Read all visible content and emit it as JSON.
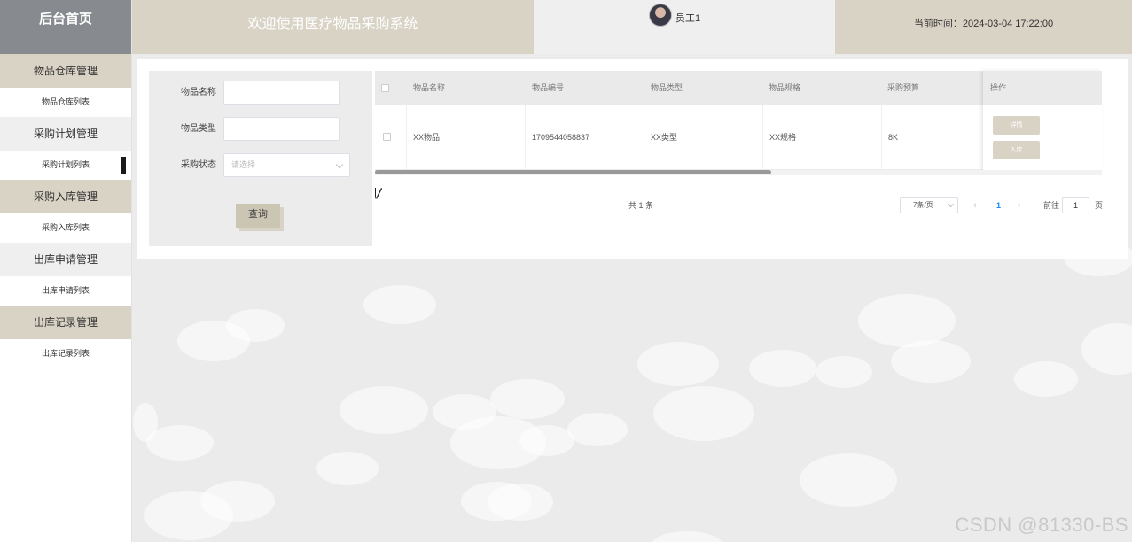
{
  "sidebar": {
    "brand": "后台首页",
    "groups": [
      {
        "label": "物品仓库管理",
        "item": "物品仓库列表"
      },
      {
        "label": "采购计划管理",
        "item": "采购计划列表"
      },
      {
        "label": "采购入库管理",
        "item": "采购入库列表"
      },
      {
        "label": "出库申请管理",
        "item": "出库申请列表"
      },
      {
        "label": "出库记录管理",
        "item": "出库记录列表"
      }
    ]
  },
  "header": {
    "title": "欢迎使用医疗物品采购系统",
    "username": "员工1",
    "time": "当前时间：2024-03-04 17:22:00"
  },
  "search": {
    "name_label": "物品名称",
    "type_label": "物品类型",
    "status_label": "采购状态",
    "status_placeholder": "请选择",
    "query_button": "查询"
  },
  "table": {
    "columns": [
      "物品名称",
      "物品编号",
      "物品类型",
      "物品规格",
      "采购预算",
      "操作"
    ],
    "rows": [
      {
        "name": "XX物品",
        "code": "1709544058837",
        "type": "XX类型",
        "spec": "XX规格",
        "budget": "8K",
        "detail": "详情",
        "stock_in": "入库"
      }
    ]
  },
  "pagination": {
    "total": "共 1 条",
    "page_size": "7条/页",
    "current_page": "1",
    "goto_label": "前往",
    "goto_value": "1",
    "page_suffix": "页"
  },
  "watermark": "CSDN @81330-BS",
  "colors": {
    "accent_beige": "#d9d3c6",
    "brand_gray": "#878b8f",
    "page_bg": "#ebebeb",
    "link_blue": "#1989fa"
  }
}
